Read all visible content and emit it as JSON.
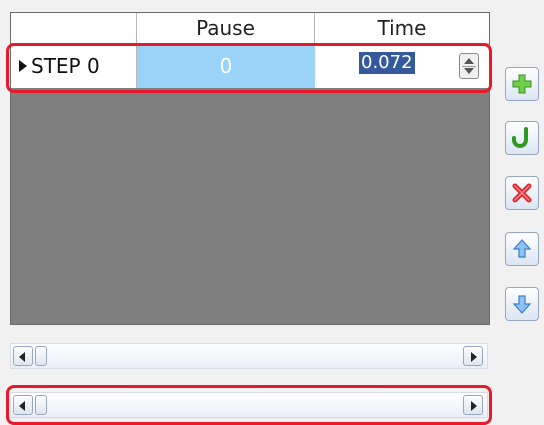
{
  "grid": {
    "columns": [
      "",
      "Pause",
      "Time"
    ],
    "rows": [
      {
        "step": "STEP 0",
        "pause": "0",
        "time": "0.072"
      }
    ]
  },
  "toolbar": {
    "buttons": [
      {
        "icon": "plus-icon",
        "color": "#5fbf3b"
      },
      {
        "icon": "hook-icon",
        "color": "#2e9a24"
      },
      {
        "icon": "delete-x-icon",
        "color": "#e3242b"
      },
      {
        "icon": "arrow-up-icon",
        "color": "#3b8ad8"
      },
      {
        "icon": "arrow-down-icon",
        "color": "#3b8ad8"
      }
    ]
  },
  "colors": {
    "grid_background": "#7f7f7f",
    "selected_cell": "#99d3f7",
    "edit_selection": "#34599c",
    "highlight": "#e8192c"
  }
}
